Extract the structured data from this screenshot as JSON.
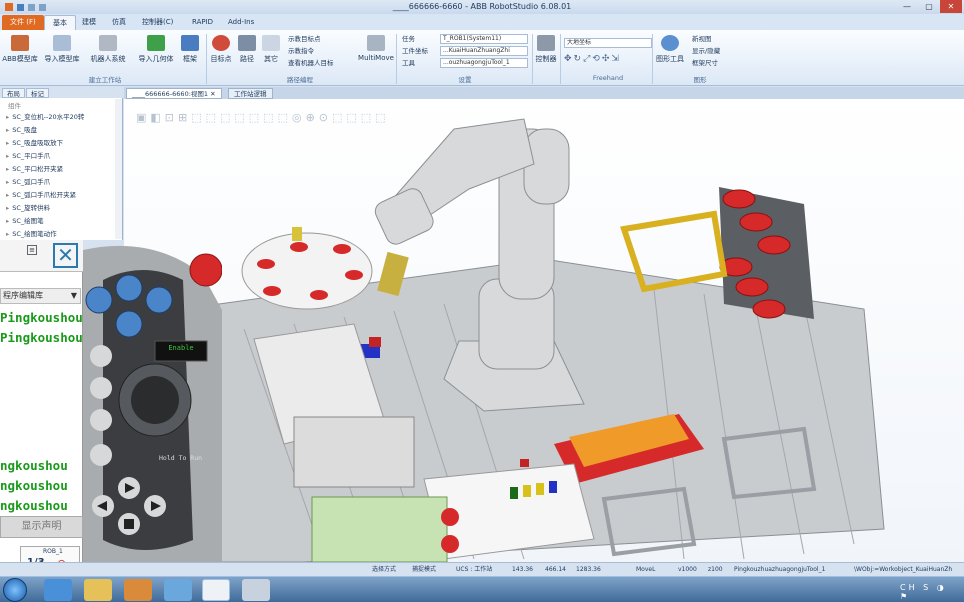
{
  "window": {
    "title": "____666666-6660 - ABB RobotStudio 6.08.01",
    "controls": [
      "—",
      "▢",
      "✕"
    ]
  },
  "tabs": [
    {
      "label": "文件 (F)"
    },
    {
      "label": "基本"
    },
    {
      "label": "建模"
    },
    {
      "label": "仿真"
    },
    {
      "label": "控制器(C)"
    },
    {
      "label": "RAPID"
    },
    {
      "label": "Add-Ins"
    }
  ],
  "ribbon": {
    "build": {
      "abb_library": "ABB模型库",
      "import_library": "导入模型库",
      "robot_system": "机器人系统",
      "import_geometry": "导入几何体",
      "frame": "框架",
      "group": "建立工作站"
    },
    "path": {
      "target": "目标点",
      "path": "路径",
      "other": "其它",
      "teach_target": "示教目标点",
      "teach_instruction": "示教指令",
      "view_robot_target": "查看机器人目标",
      "multimove": "MultiMove",
      "group": "路径编程"
    },
    "settings": {
      "task_label": "任务",
      "task_value": "T_ROB1(System11)",
      "wobj_label": "工件坐标",
      "wobj_value": "...KuaiHuanZhuangZhi",
      "tool_label": "工具",
      "tool_value": "...ouzhuagongjuTool_1",
      "group": "设置"
    },
    "controller": {
      "label": "控制器"
    },
    "freehand": {
      "frame_value": "大地坐标",
      "group": "Freehand"
    },
    "graphics": {
      "view": "图形工具",
      "new_view": "新视图",
      "show_hide": "显示/隐藏",
      "frame_size": "框架尺寸",
      "group": "图形"
    }
  },
  "left_panel": {
    "tabs": [
      "布局",
      "标记"
    ],
    "tree_header": "组件",
    "items": [
      "SC_变位机--20水平20转",
      "SC_吸盘",
      "SC_吸盘吸取放下",
      "SC_平口手爪",
      "SC_平口松开夹紧",
      "SC_弧口手爪",
      "SC_弧口手爪松开夹紧",
      "SC_旋转供料",
      "SC_绘图笔",
      "SC_绘图笔动作"
    ]
  },
  "document": {
    "tabs": [
      "____666666-6660:视图1",
      "工作站逻辑"
    ]
  },
  "flexpendant": {
    "dropdown": "程序编辑库",
    "lines": [
      "Pingkoushou",
      "Pingkoushou",
      "ngkoushou",
      "ngkoushou",
      "ngkoushou"
    ],
    "show_declaration": "显示声明",
    "page": "1/3",
    "rob_label": "ROB_1",
    "enable": "Enable",
    "hold_to_run": "Hold To Run"
  },
  "status": {
    "select_mode": "选择方式",
    "snap_mode": "捕捉模式",
    "ucs": "UCS : 工作站",
    "x": "143.36",
    "y": "466.14",
    "z": "1283.36",
    "instruction": "MoveL",
    "speed": "v1000",
    "zone": "z100",
    "tool": "PingkouzhuazhuagongjuTool_1",
    "wobj": "\\WObj:=Workobject_KuaiHuanZh"
  },
  "colors": {
    "accent": "#e06a22",
    "tool_red": "#d62a2a",
    "ribbon": "#dce8f6",
    "enable_green": "#1a9a1a"
  }
}
